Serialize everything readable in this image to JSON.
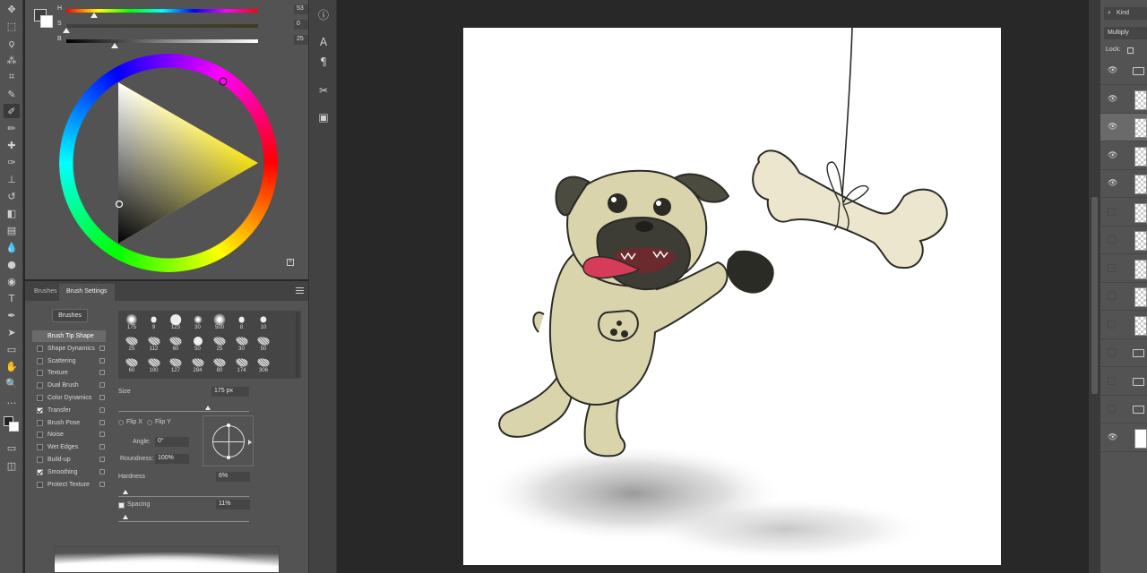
{
  "toolbar": {
    "tools": [
      {
        "name": "move-tool",
        "glyph": "✥"
      },
      {
        "name": "marquee-tool",
        "glyph": "⬚"
      },
      {
        "name": "lasso-tool",
        "glyph": "ϙ"
      },
      {
        "name": "magic-wand-tool",
        "glyph": "⁂"
      },
      {
        "name": "crop-tool",
        "glyph": "⌗"
      },
      {
        "name": "eyedropper-tool",
        "glyph": "✎"
      },
      {
        "name": "brush-tool",
        "glyph": "✐"
      },
      {
        "name": "pencil-tool",
        "glyph": "✏"
      },
      {
        "name": "healing-tool",
        "glyph": "✚"
      },
      {
        "name": "mixer-brush-tool",
        "glyph": "✑"
      },
      {
        "name": "clone-stamp-tool",
        "glyph": "⊥"
      },
      {
        "name": "history-brush-tool",
        "glyph": "↺"
      },
      {
        "name": "eraser-tool",
        "glyph": "◧"
      },
      {
        "name": "gradient-tool",
        "glyph": "▤"
      },
      {
        "name": "blur-tool",
        "glyph": "💧"
      },
      {
        "name": "dodge-tool",
        "glyph": "●"
      },
      {
        "name": "burn-tool",
        "glyph": "◉"
      },
      {
        "name": "type-tool",
        "glyph": "T"
      },
      {
        "name": "pen-tool",
        "glyph": "✒"
      },
      {
        "name": "path-select-tool",
        "glyph": "➤"
      },
      {
        "name": "shape-tool",
        "glyph": "▭"
      },
      {
        "name": "hand-tool",
        "glyph": "✋"
      },
      {
        "name": "zoom-tool",
        "glyph": "🔍"
      },
      {
        "name": "more-tools",
        "glyph": "…"
      }
    ],
    "active_tool": "brush-tool"
  },
  "color_panel": {
    "sliders": [
      {
        "label": "H",
        "value": "53",
        "unit": "°",
        "fraction": 0.147
      },
      {
        "label": "S",
        "value": "0",
        "unit": "%",
        "fraction": 0.0
      },
      {
        "label": "B",
        "value": "25",
        "unit": "%",
        "fraction": 0.25
      }
    ],
    "foreground_color": "#404040",
    "background_color": "#ffffff",
    "hue_color": "#f5e10a"
  },
  "brush_panel": {
    "tabs": [
      "Brushes",
      "Brush Settings"
    ],
    "active_tab": "Brush Settings",
    "brushes_button": "Brushes",
    "options": [
      {
        "label": "Brush Tip Shape",
        "checkbox": false,
        "checked": false,
        "lock": false,
        "selected": true
      },
      {
        "label": "Shape Dynamics",
        "checkbox": true,
        "checked": false,
        "lock": true
      },
      {
        "label": "Scattering",
        "checkbox": true,
        "checked": false,
        "lock": true
      },
      {
        "label": "Texture",
        "checkbox": true,
        "checked": false,
        "lock": true
      },
      {
        "label": "Dual Brush",
        "checkbox": true,
        "checked": false,
        "lock": true
      },
      {
        "label": "Color Dynamics",
        "checkbox": true,
        "checked": false,
        "lock": true
      },
      {
        "label": "Transfer",
        "checkbox": true,
        "checked": true,
        "lock": true
      },
      {
        "label": "Brush Pose",
        "checkbox": true,
        "checked": false,
        "lock": true
      },
      {
        "label": "Noise",
        "checkbox": true,
        "checked": false,
        "lock": true
      },
      {
        "label": "Wet Edges",
        "checkbox": true,
        "checked": false,
        "lock": true
      },
      {
        "label": "Build-up",
        "checkbox": true,
        "checked": false,
        "lock": true
      },
      {
        "label": "Smoothing",
        "checkbox": true,
        "checked": true,
        "lock": true
      },
      {
        "label": "Protect Texture",
        "checkbox": true,
        "checked": false,
        "lock": true
      }
    ],
    "brush_tips": [
      {
        "size": "175",
        "kind": "soft"
      },
      {
        "size": "9",
        "kind": "hard"
      },
      {
        "size": "123",
        "kind": "hard"
      },
      {
        "size": "30",
        "kind": "soft"
      },
      {
        "size": "500",
        "kind": "soft"
      },
      {
        "size": "8",
        "kind": "hard"
      },
      {
        "size": "10",
        "kind": "hard"
      },
      {
        "size": "25",
        "kind": "texture"
      },
      {
        "size": "112",
        "kind": "texture"
      },
      {
        "size": "60",
        "kind": "texture"
      },
      {
        "size": "50",
        "kind": "hard"
      },
      {
        "size": "25",
        "kind": "texture"
      },
      {
        "size": "30",
        "kind": "texture"
      },
      {
        "size": "50",
        "kind": "texture"
      },
      {
        "size": "60",
        "kind": "texture"
      },
      {
        "size": "100",
        "kind": "texture"
      },
      {
        "size": "127",
        "kind": "texture"
      },
      {
        "size": "284",
        "kind": "texture"
      },
      {
        "size": "80",
        "kind": "texture"
      },
      {
        "size": "174",
        "kind": "texture"
      },
      {
        "size": "306",
        "kind": "texture"
      }
    ],
    "size_label": "Size",
    "size_value": "175 px",
    "flip_x": "Flip X",
    "flip_y": "Flip Y",
    "angle_label": "Angle:",
    "angle_value": "0°",
    "roundness_label": "Roundness:",
    "roundness_value": "100%",
    "hardness_label": "Hardness",
    "hardness_value": "6%",
    "spacing_label": "Spacing",
    "spacing_value": "11%",
    "spacing_checked": true
  },
  "mid_strip": {
    "icons": [
      {
        "name": "info-icon",
        "glyph": "ⓘ"
      },
      {
        "name": "character-icon",
        "glyph": "A"
      },
      {
        "name": "paragraph-icon",
        "glyph": "¶"
      },
      {
        "name": "tools-icon",
        "glyph": "✂"
      },
      {
        "name": "navigator-icon",
        "glyph": "▣"
      }
    ]
  },
  "layers_panel": {
    "filter_kind": "Kind",
    "blend_mode": "Multiply",
    "lock_label": "Lock:",
    "rows": [
      {
        "visible": true,
        "type": "group"
      },
      {
        "visible": true,
        "type": "layer"
      },
      {
        "visible": true,
        "type": "layer",
        "selected": true
      },
      {
        "visible": true,
        "type": "layer"
      },
      {
        "visible": true,
        "type": "layer"
      },
      {
        "visible": false,
        "type": "layer"
      },
      {
        "visible": false,
        "type": "layer"
      },
      {
        "visible": false,
        "type": "layer"
      },
      {
        "visible": false,
        "type": "layer"
      },
      {
        "visible": false,
        "type": "layer"
      },
      {
        "visible": false,
        "type": "group"
      },
      {
        "visible": false,
        "type": "group"
      },
      {
        "visible": false,
        "type": "group"
      },
      {
        "visible": true,
        "type": "background"
      }
    ]
  },
  "canvas": {
    "background": "#ffffff",
    "pug_body_color": "#d9d4ac",
    "bone_color": "#ece6cf",
    "tongue_color": "#d63c57",
    "outline_color": "#2b2b26"
  }
}
